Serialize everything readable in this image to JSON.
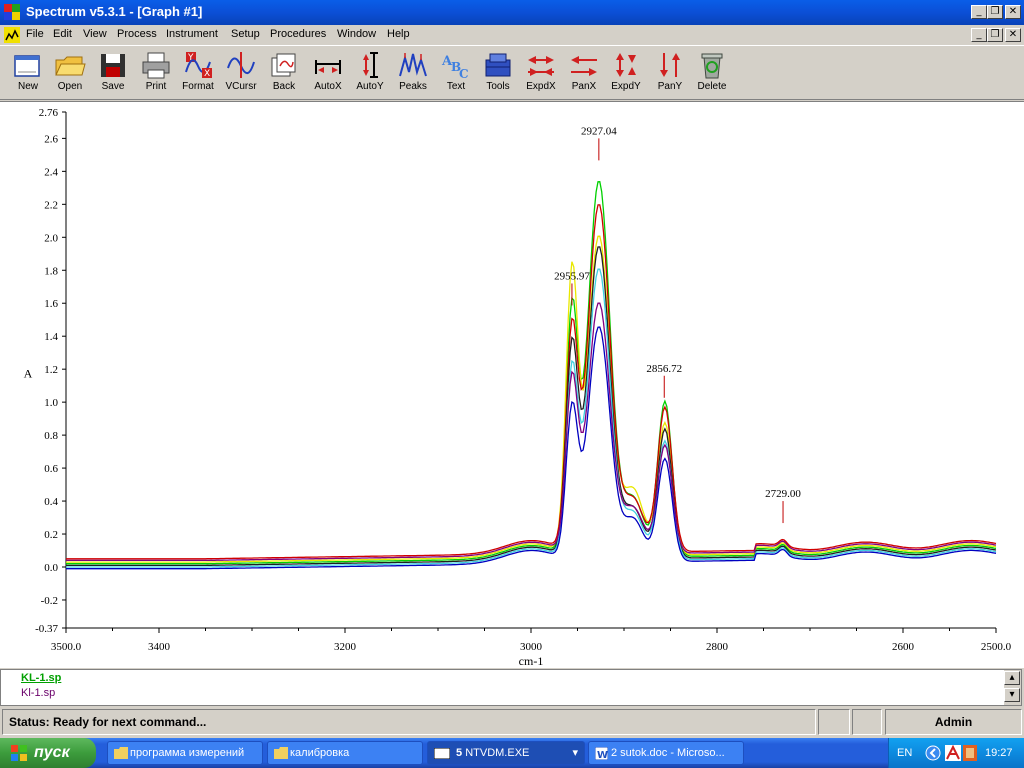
{
  "window": {
    "title": "Spectrum v5.3.1 - [Graph #1]",
    "min_glyph": "_",
    "restore_glyph": "❐",
    "close_glyph": "✕"
  },
  "menu": [
    "File",
    "Edit",
    "View",
    "Process",
    "Instrument",
    "Setup",
    "Procedures",
    "Window",
    "Help"
  ],
  "toolbar": [
    {
      "label": "New",
      "icon": "new-file-icon"
    },
    {
      "label": "Open",
      "icon": "open-folder-icon"
    },
    {
      "label": "Save",
      "icon": "floppy-icon"
    },
    {
      "label": "Print",
      "icon": "printer-icon"
    },
    {
      "label": "Format",
      "icon": "format-icon"
    },
    {
      "label": "VCursr",
      "icon": "vcursor-icon"
    },
    {
      "label": "Back",
      "icon": "back-icon"
    },
    {
      "label": "AutoX",
      "icon": "autox-icon"
    },
    {
      "label": "AutoY",
      "icon": "autoy-icon"
    },
    {
      "label": "Peaks",
      "icon": "peaks-icon"
    },
    {
      "label": "Text",
      "icon": "text-icon"
    },
    {
      "label": "Tools",
      "icon": "tools-icon"
    },
    {
      "label": "ExpdX",
      "icon": "expandx-icon"
    },
    {
      "label": "PanX",
      "icon": "panx-icon"
    },
    {
      "label": "ExpdY",
      "icon": "expandy-icon"
    },
    {
      "label": "PanY",
      "icon": "pany-icon"
    },
    {
      "label": "Delete",
      "icon": "recycle-bin-icon"
    }
  ],
  "chart_data": {
    "type": "line",
    "xlabel": "cm-1",
    "ylabel": "A",
    "xlim": [
      3500.0,
      2500.0
    ],
    "ylim": [
      -0.37,
      2.76
    ],
    "x_ticks": [
      3500.0,
      3400,
      3200,
      3000,
      2800,
      2600,
      2500.0
    ],
    "x_tick_labels": [
      "3500.0",
      "3400",
      "3200",
      "3000",
      "2800",
      "2600",
      "2500.0"
    ],
    "y_ticks": [
      -0.37,
      -0.2,
      0.0,
      0.2,
      0.4,
      0.6,
      0.8,
      1.0,
      1.2,
      1.4,
      1.6,
      1.8,
      2.0,
      2.2,
      2.4,
      2.6,
      2.76
    ],
    "y_tick_labels": [
      "-0.37",
      "-0.2",
      "0.0",
      "0.2",
      "0.4",
      "0.6",
      "0.8",
      "1.0",
      "1.2",
      "1.4",
      "1.6",
      "1.8",
      "2.0",
      "2.2",
      "2.4",
      "2.6",
      "2.76"
    ],
    "peaks": [
      {
        "x": 2927.04,
        "y": 2.6,
        "label": "2927.04"
      },
      {
        "x": 2955.97,
        "y": 1.72,
        "label": "2955.97"
      },
      {
        "x": 2856.72,
        "y": 1.16,
        "label": "2856.72"
      },
      {
        "x": 2729.0,
        "y": 0.4,
        "label": "2729.00"
      }
    ],
    "series": [
      {
        "color": "#00d000",
        "peak2927": 2.38,
        "peak2956": 1.5,
        "valley": 0.64,
        "peak2857": 1.1,
        "base": 0.02
      },
      {
        "color": "#e8e800",
        "peak2927": 2.05,
        "peak2956": 1.72,
        "valley": 0.72,
        "peak2857": 0.98,
        "base": 0.03
      },
      {
        "color": "#d00000",
        "peak2927": 2.2,
        "peak2956": 1.35,
        "valley": 0.58,
        "peak2857": 1.02,
        "base": 0.05
      },
      {
        "color": "#202020",
        "peak2927": 1.98,
        "peak2956": 1.28,
        "valley": 0.55,
        "peak2857": 0.92,
        "base": 0.01
      },
      {
        "color": "#40d0e0",
        "peak2927": 1.85,
        "peak2956": 1.15,
        "valley": 0.52,
        "peak2857": 0.85,
        "base": 0.0
      },
      {
        "color": "#800080",
        "peak2927": 1.6,
        "peak2956": 1.05,
        "valley": 0.5,
        "peak2857": 0.78,
        "base": 0.04
      },
      {
        "color": "#0000c0",
        "peak2927": 1.5,
        "peak2956": 0.92,
        "valley": 0.47,
        "peak2857": 0.74,
        "base": -0.01
      }
    ]
  },
  "files": [
    "KL-1.sp",
    "Kl-1.sp"
  ],
  "status": {
    "text": "Status: Ready for next command...",
    "user": "Admin"
  },
  "taskbar": {
    "start_label": "пуск",
    "tasks": [
      "программа измерений",
      "калибровка",
      "NTVDM.EXE",
      "2 sutok.doc - Microso..."
    ],
    "task_count": "5",
    "lang": "EN",
    "clock": "19:27"
  }
}
